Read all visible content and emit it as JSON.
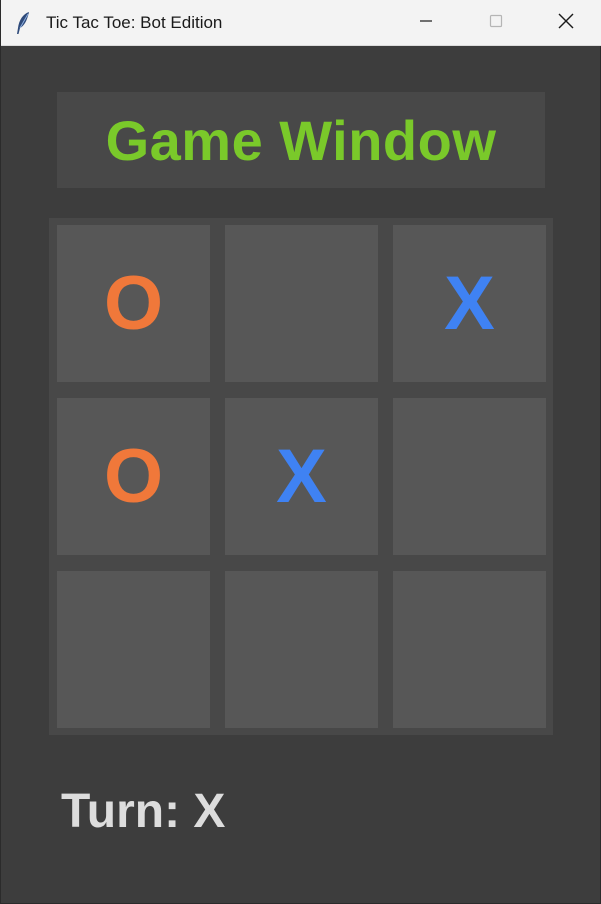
{
  "window": {
    "title": "Tic Tac Toe: Bot Edition",
    "icon": "feather-icon"
  },
  "header": {
    "title": "Game Window",
    "title_color": "#7ac92a"
  },
  "board": {
    "cells": [
      "O",
      "",
      "X",
      "O",
      "X",
      "",
      "",
      "",
      ""
    ],
    "colors": {
      "O": "#f0783a",
      "X": "#3f82f3"
    }
  },
  "status": {
    "turn_text": "Turn: X"
  }
}
